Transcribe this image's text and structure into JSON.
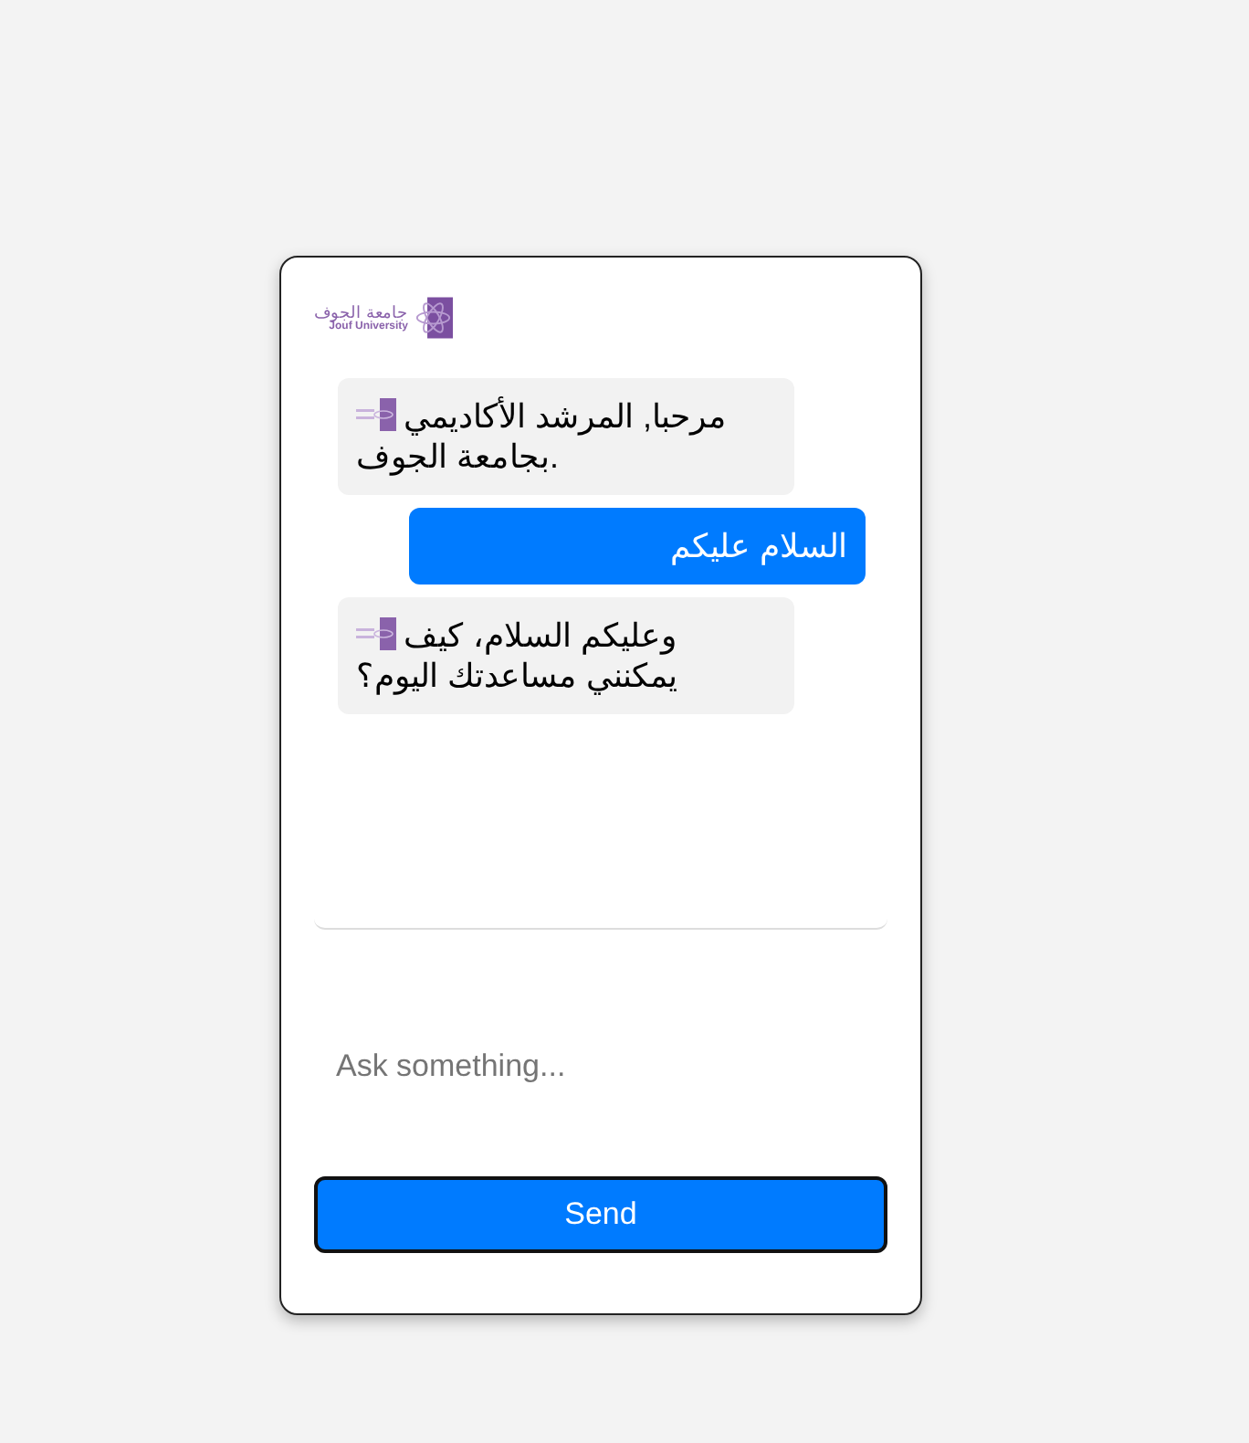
{
  "header": {
    "logo_arabic": "جامعة الجوف",
    "logo_english": "Jouf University"
  },
  "messages": [
    {
      "kind": "bot",
      "text": "مرحبا, المرشد الأكاديمي بجامعة الجوف."
    },
    {
      "kind": "user",
      "text": "السلام عليكم"
    },
    {
      "kind": "bot",
      "text": "وعليكم السلام، كيف يمكنني مساعدتك اليوم؟"
    }
  ],
  "input": {
    "placeholder": "Ask something..."
  },
  "send_button": "Send"
}
